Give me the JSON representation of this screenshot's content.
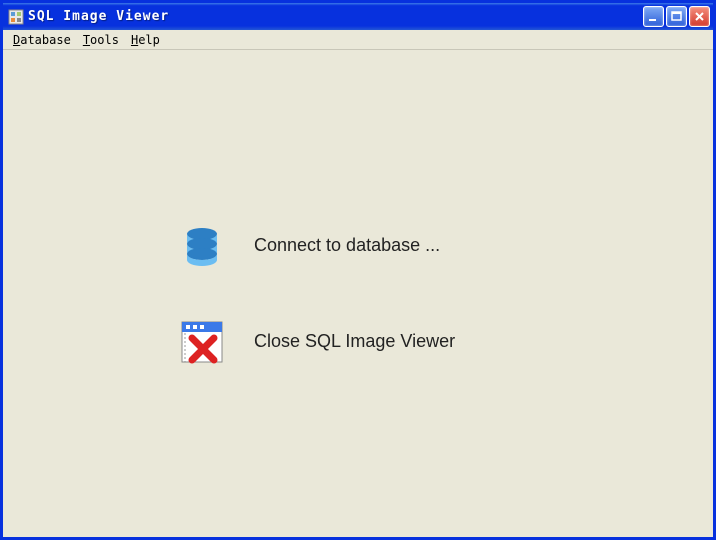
{
  "window": {
    "title": "SQL Image Viewer"
  },
  "menubar": {
    "database": "Database",
    "tools": "Tools",
    "help": "Help"
  },
  "actions": {
    "connect": "Connect to database ...",
    "close": "Close SQL Image Viewer"
  }
}
